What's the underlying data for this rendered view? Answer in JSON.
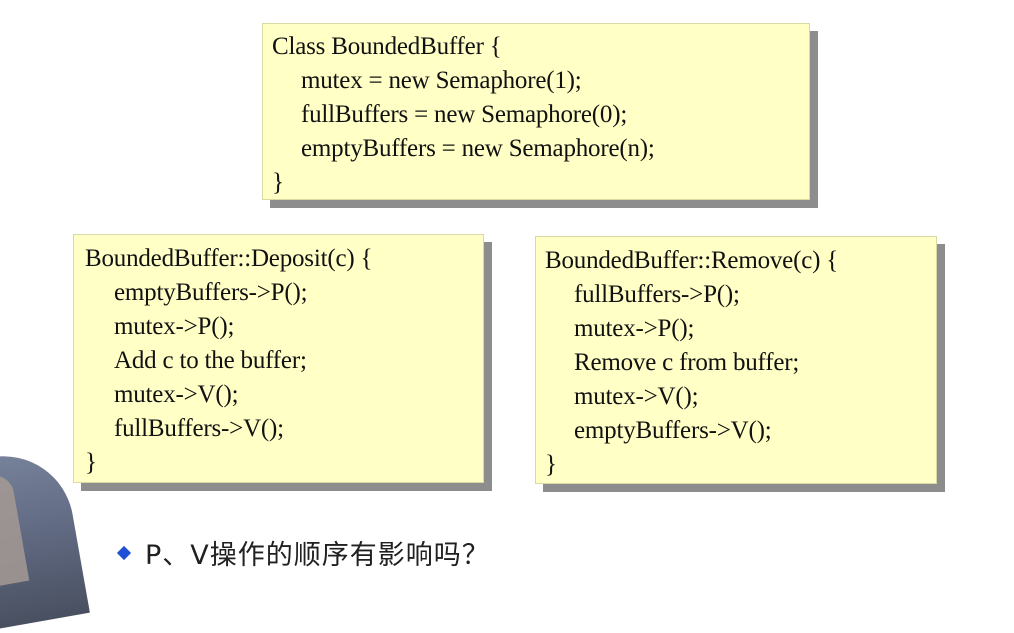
{
  "slide": {
    "class_box": {
      "lines": [
        "Class BoundedBuffer {",
        "mutex = new Semaphore(1);",
        "fullBuffers = new Semaphore(0);",
        "emptyBuffers = new Semaphore(n);",
        "}"
      ]
    },
    "deposit_box": {
      "lines": [
        "BoundedBuffer::Deposit(c) {",
        "emptyBuffers->P();",
        "mutex->P();",
        "Add c to the buffer;",
        "mutex->V();",
        "fullBuffers->V();",
        "}"
      ]
    },
    "remove_box": {
      "lines": [
        "BoundedBuffer::Remove(c) {",
        "fullBuffers->P();",
        "mutex->P();",
        "Remove c from buffer;",
        "mutex->V();",
        "emptyBuffers->V();",
        "}"
      ]
    },
    "bullet": {
      "icon": "diamond-icon",
      "text": "P、V操作的顺序有影响吗？"
    }
  },
  "colors": {
    "code_box_background": "#ffffc6",
    "code_box_shadow": "#8d8d8d",
    "bullet_icon": "#1f4fd6"
  }
}
